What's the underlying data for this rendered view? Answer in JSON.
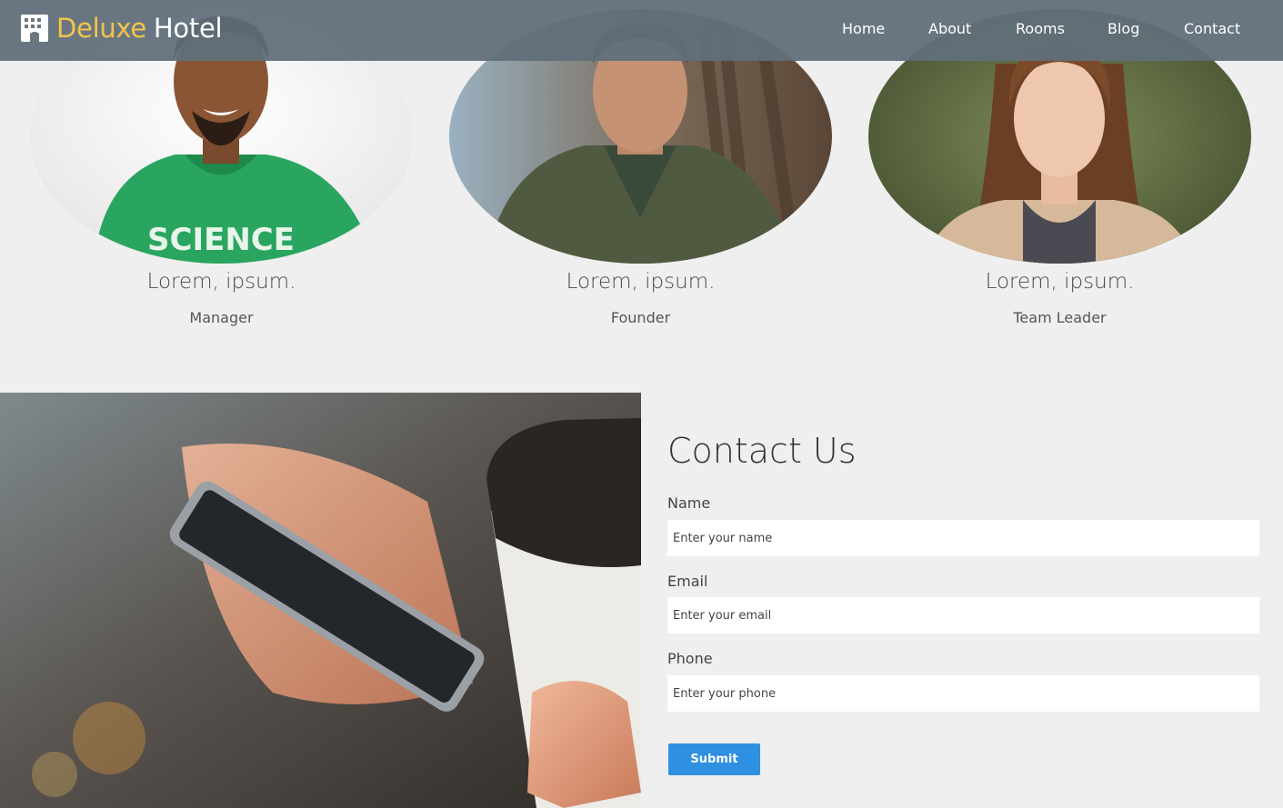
{
  "brand": {
    "first": "Deluxe",
    "second": "Hotel",
    "icon": "hotel-building-icon",
    "accent_color": "#f2c54a"
  },
  "nav": {
    "items": [
      {
        "label": "Home"
      },
      {
        "label": "About"
      },
      {
        "label": "Rooms"
      },
      {
        "label": "Blog"
      },
      {
        "label": "Contact"
      }
    ]
  },
  "team": {
    "members": [
      {
        "name": "Lorem, ipsum.",
        "role": "Manager"
      },
      {
        "name": "Lorem, ipsum.",
        "role": "Founder"
      },
      {
        "name": "Lorem, ipsum.",
        "role": "Team Leader"
      }
    ]
  },
  "contact": {
    "title": "Contact Us",
    "fields": [
      {
        "label": "Name",
        "placeholder": "Enter your name"
      },
      {
        "label": "Email",
        "placeholder": "Enter your email"
      },
      {
        "label": "Phone",
        "placeholder": "Enter your phone"
      }
    ],
    "submit_label": "Submit",
    "button_color": "#2f8fe0"
  }
}
